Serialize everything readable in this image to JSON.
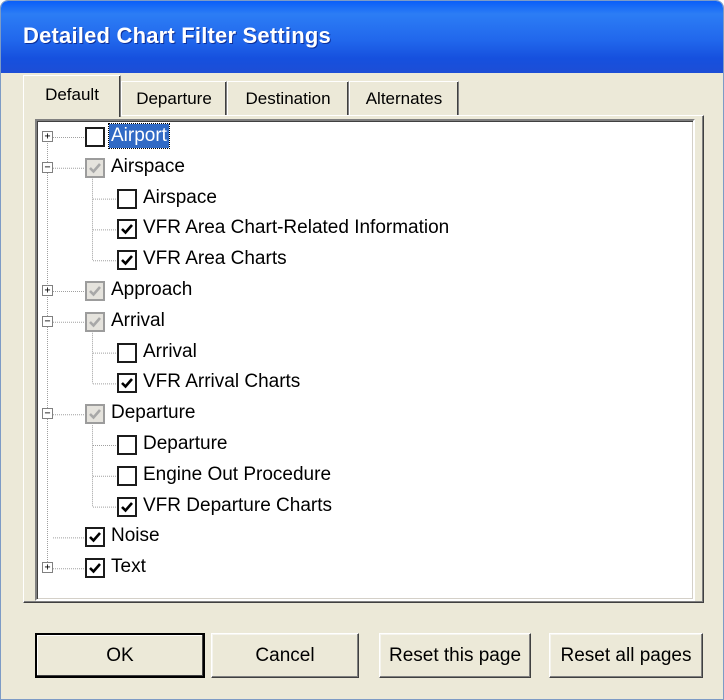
{
  "window": {
    "title": "Detailed Chart Filter Settings"
  },
  "tabs": [
    {
      "label": "Default",
      "active": true
    },
    {
      "label": "Departure",
      "active": false
    },
    {
      "label": "Destination",
      "active": false
    },
    {
      "label": "Alternates",
      "active": false
    }
  ],
  "tree": [
    {
      "label": "Airport",
      "level": 0,
      "expander": "plus",
      "state": "unchecked",
      "selected": true
    },
    {
      "label": "Airspace",
      "level": 0,
      "expander": "minus",
      "state": "indeterminate"
    },
    {
      "label": "Airspace",
      "level": 1,
      "state": "unchecked"
    },
    {
      "label": "VFR Area Chart-Related Information",
      "level": 1,
      "state": "checked"
    },
    {
      "label": "VFR Area Charts",
      "level": 1,
      "state": "checked"
    },
    {
      "label": "Approach",
      "level": 0,
      "expander": "plus",
      "state": "indeterminate"
    },
    {
      "label": "Arrival",
      "level": 0,
      "expander": "minus",
      "state": "indeterminate"
    },
    {
      "label": "Arrival",
      "level": 1,
      "state": "unchecked"
    },
    {
      "label": "VFR Arrival Charts",
      "level": 1,
      "state": "checked"
    },
    {
      "label": "Departure",
      "level": 0,
      "expander": "minus",
      "state": "indeterminate"
    },
    {
      "label": "Departure",
      "level": 1,
      "state": "unchecked"
    },
    {
      "label": "Engine Out Procedure",
      "level": 1,
      "state": "unchecked"
    },
    {
      "label": "VFR Departure Charts",
      "level": 1,
      "state": "checked"
    },
    {
      "label": "Noise",
      "level": 0,
      "expander": "none",
      "state": "checked"
    },
    {
      "label": "Text",
      "level": 0,
      "expander": "plus",
      "state": "checked"
    }
  ],
  "buttons": {
    "ok": "OK",
    "cancel": "Cancel",
    "reset_page": "Reset this page",
    "reset_all": "Reset all pages"
  },
  "colors": {
    "title_bar": "#2167ec",
    "dialog_bg": "#ece9d8",
    "selection": "#316ac5"
  }
}
